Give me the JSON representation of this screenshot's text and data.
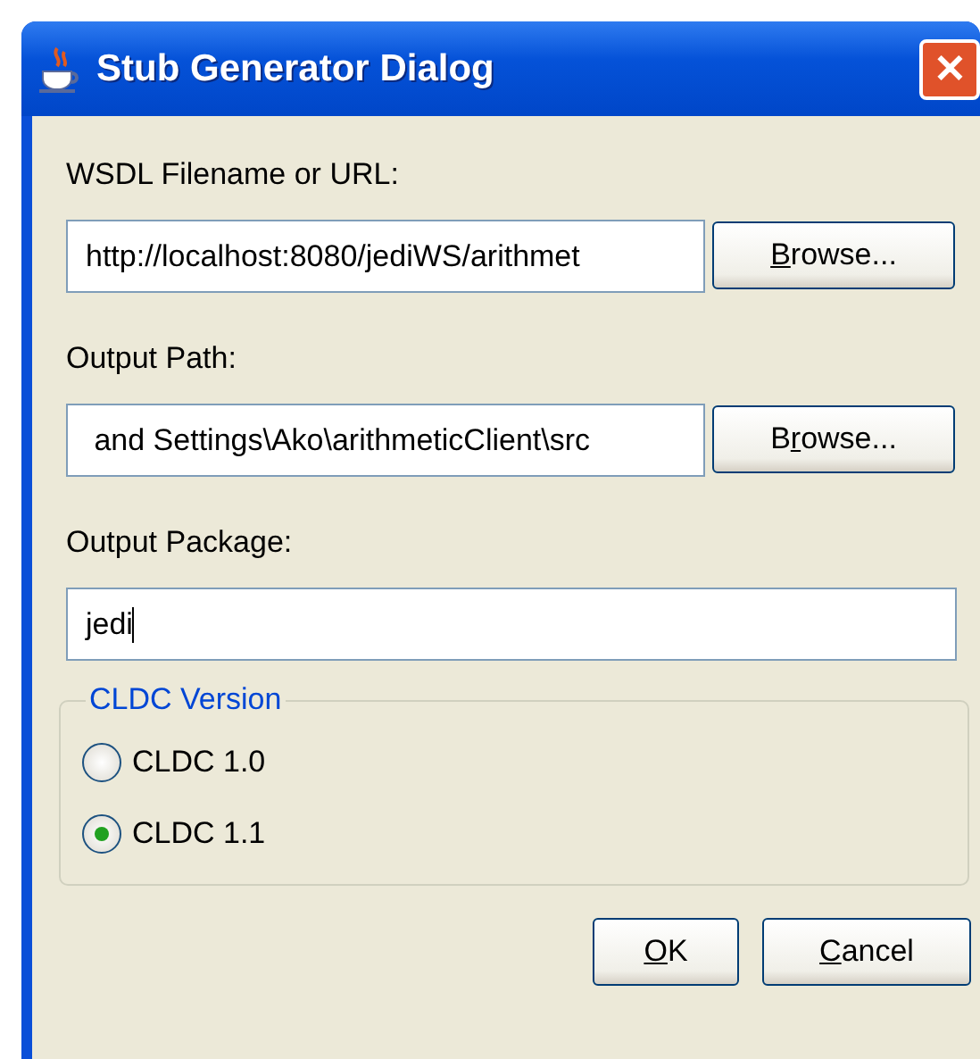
{
  "window": {
    "title": "Stub Generator Dialog",
    "close": "✕"
  },
  "fields": [
    {
      "label": "WSDL Filename or URL:",
      "value": "http://localhost:8080/jediWS/arithmet",
      "button": {
        "key": "B",
        "post": "rowse..."
      }
    },
    {
      "label": "Output Path:",
      "value": " and Settings\\Ako\\arithmeticClient\\src",
      "button": {
        "pre": "B",
        "key": "r",
        "post": "owse..."
      }
    },
    {
      "label": "Output Package:",
      "value": "jedi",
      "focused": true
    }
  ],
  "group": {
    "legend": "CLDC Version",
    "options": [
      {
        "label": "CLDC 1.0",
        "selected": false
      },
      {
        "label": "CLDC 1.1",
        "selected": true
      }
    ]
  },
  "buttons": [
    {
      "key": "O",
      "post": "K"
    },
    {
      "key": "C",
      "post": "ancel"
    }
  ]
}
